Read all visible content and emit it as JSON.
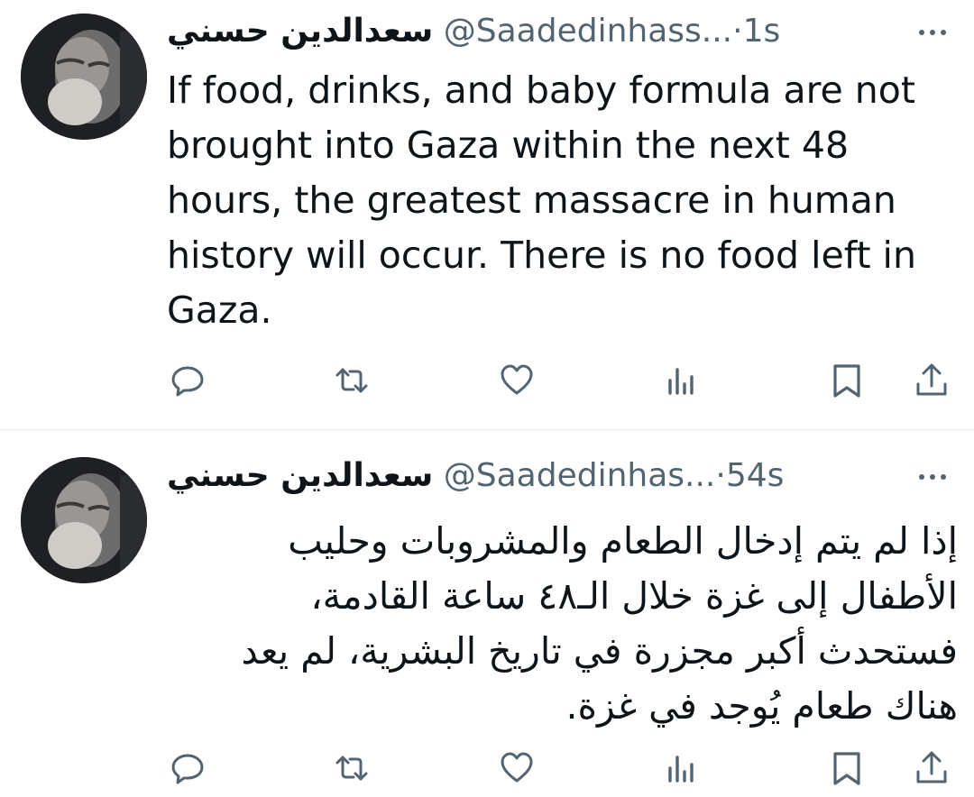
{
  "tweets": [
    {
      "display_name": "سعدالدين حسني",
      "handle": "@Saadedinhass...",
      "separator": "·",
      "time": "1s",
      "text": "If food, drinks, and baby formula are not brought into Gaza within the next 48 hours, the greatest massacre in human history will occur. There is no food left in Gaza.",
      "icons": [
        "reply-icon",
        "retweet-icon",
        "like-icon",
        "views-icon",
        "bookmark-icon",
        "share-icon"
      ]
    },
    {
      "display_name": "سعدالدين حسني",
      "handle": "@Saadedinhas...",
      "separator": "·",
      "time": "54s",
      "text": "إذا لم يتم إدخال الطعام والمشروبات وحليب الأطفال إلى غزة خلال الـ٤٨ ساعة القادمة، فستحدث أكبر مجزرة في تاريخ البشرية، لم يعد هناك طعام يُوجد في غزة.",
      "icons": [
        "reply-icon",
        "retweet-icon",
        "like-icon",
        "views-icon",
        "bookmark-icon",
        "share-icon"
      ]
    }
  ],
  "colors": {
    "text": "#0f1419",
    "secondary": "#536471",
    "divider": "#e6e9eb"
  }
}
